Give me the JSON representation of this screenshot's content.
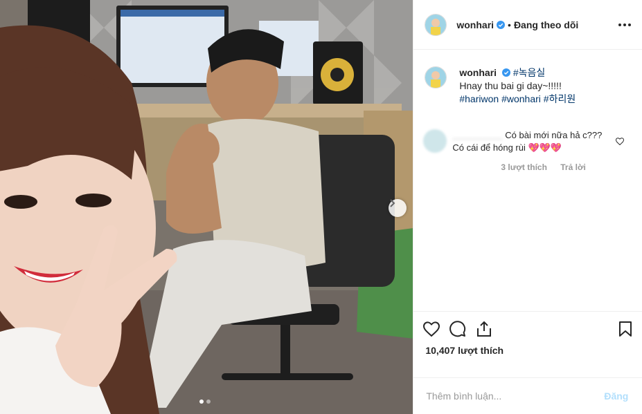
{
  "post": {
    "username": "wonhari",
    "separator": "•",
    "follow_status": "Đang theo dõi",
    "caption": {
      "username": "wonhari",
      "line1": "#녹음실",
      "line2": "Hnay thu bai gi day~!!!!!",
      "hashtags": [
        "#hariwon",
        "#wonhari",
        "#하리원"
      ]
    },
    "comment": {
      "username": "blurred",
      "text": "Có bài mới nữa hả c??? Có cái để hóng rùi 💖💖💖",
      "likes": "3 lượt thích",
      "reply": "Trả lời"
    },
    "likes_count": "10,407 lượt thích",
    "add_comment_placeholder": "Thêm bình luận...",
    "post_button": "Đăng",
    "carousel": {
      "total": 2,
      "current": 1
    }
  },
  "icons": {
    "verified": "verified-badge-icon",
    "more": "more-options-icon",
    "like": "heart-icon",
    "comment": "comment-icon",
    "share": "share-icon",
    "save": "bookmark-icon",
    "next": "chevron-right-icon"
  },
  "colors": {
    "verified": "#3897f0",
    "hashtag": "#003569",
    "post_button_disabled": "#b2dffc",
    "muted_text": "#999999"
  }
}
